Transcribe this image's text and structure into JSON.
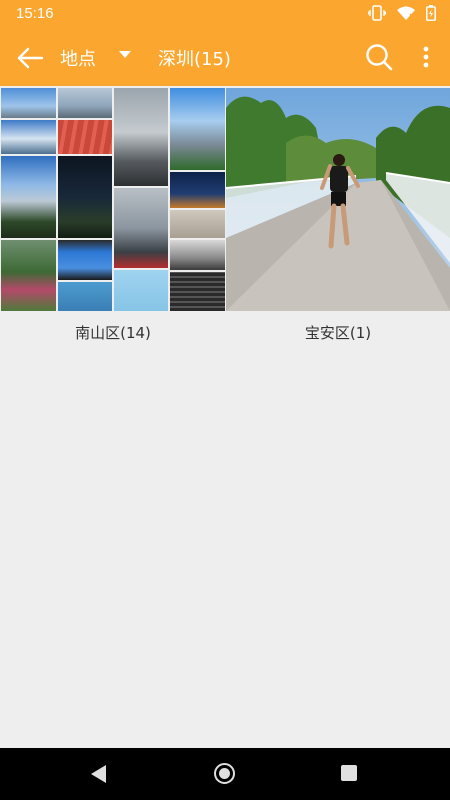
{
  "status_bar": {
    "time": "15:16",
    "icons": [
      "vibrate-icon",
      "wifi-icon",
      "battery-icon"
    ]
  },
  "app_bar": {
    "title": "地点",
    "subtitle": "深圳(15)",
    "accent_color": "#fba72f",
    "icons": [
      "back-arrow-icon",
      "dropdown-icon",
      "search-icon",
      "more-vert-icon"
    ]
  },
  "albums": [
    {
      "label": "南山区(14)"
    },
    {
      "label": "宝安区(1)"
    }
  ],
  "nav_bar": {
    "icons": [
      "nav-back-icon",
      "nav-home-icon",
      "nav-recents-icon"
    ]
  }
}
